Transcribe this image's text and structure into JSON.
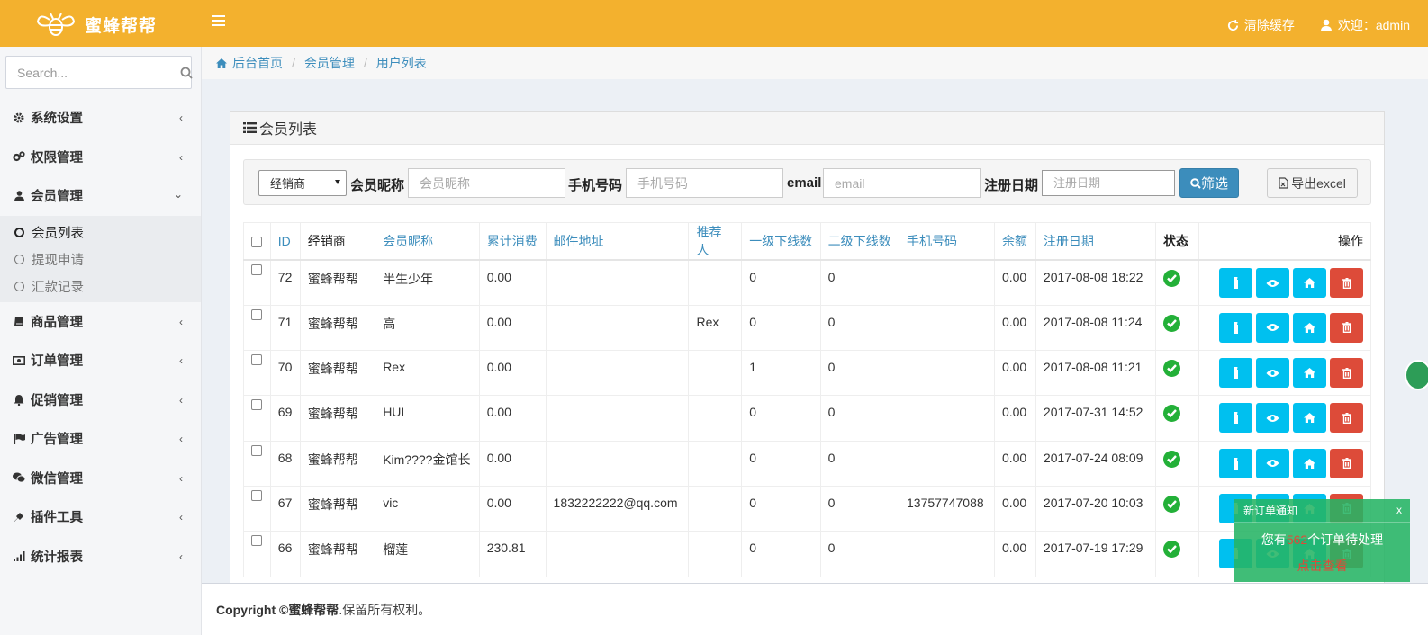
{
  "header": {
    "brand": "蜜蜂帮帮",
    "clear_cache": "清除缓存",
    "welcome": "欢迎：admin"
  },
  "sidebar": {
    "search_placeholder": "Search...",
    "items": [
      {
        "label": "系统设置",
        "icon": "gear-icon"
      },
      {
        "label": "权限管理",
        "icon": "gears-icon"
      },
      {
        "label": "会员管理",
        "icon": "user-icon",
        "open": true,
        "children": [
          {
            "label": "会员列表",
            "active": true
          },
          {
            "label": "提现申请"
          },
          {
            "label": "汇款记录"
          }
        ]
      },
      {
        "label": "商品管理",
        "icon": "book-icon"
      },
      {
        "label": "订单管理",
        "icon": "money-icon"
      },
      {
        "label": "促销管理",
        "icon": "bell-icon"
      },
      {
        "label": "广告管理",
        "icon": "flag-icon"
      },
      {
        "label": "微信管理",
        "icon": "wechat-icon"
      },
      {
        "label": "插件工具",
        "icon": "plug-icon"
      },
      {
        "label": "统计报表",
        "icon": "signal-icon"
      }
    ]
  },
  "breadcrumb": [
    "后台首页",
    "会员管理",
    "用户列表"
  ],
  "panel": {
    "title": "会员列表",
    "filter": {
      "dealer_selected": "经销商",
      "nickname_label": "会员昵称",
      "nickname_placeholder": "会员昵称",
      "phone_label": "手机号码",
      "phone_placeholder": "手机号码",
      "email_label": "email",
      "email_placeholder": "email",
      "date_label": "注册日期",
      "date_placeholder": "注册日期",
      "filter_button": "筛选",
      "export_button": "导出excel"
    }
  },
  "table": {
    "columns": [
      "ID",
      "经销商",
      "会员昵称",
      "累计消费",
      "邮件地址",
      "推荐人",
      "一级下线数",
      "二级下线数",
      "手机号码",
      "余额",
      "注册日期",
      "状态",
      "操作"
    ],
    "rows": [
      {
        "id": "72",
        "dealer": "蜜蜂帮帮",
        "nickname": "半生少年",
        "spend": "0.00",
        "email": "",
        "referrer": "",
        "l1": "0",
        "l2": "0",
        "phone": "",
        "balance": "0.00",
        "date": "2017-08-08 18:22"
      },
      {
        "id": "71",
        "dealer": "蜜蜂帮帮",
        "nickname": "高",
        "spend": "0.00",
        "email": "",
        "referrer": "Rex",
        "l1": "0",
        "l2": "0",
        "phone": "",
        "balance": "0.00",
        "date": "2017-08-08 11:24"
      },
      {
        "id": "70",
        "dealer": "蜜蜂帮帮",
        "nickname": "Rex",
        "spend": "0.00",
        "email": "",
        "referrer": "",
        "l1": "1",
        "l2": "0",
        "phone": "",
        "balance": "0.00",
        "date": "2017-08-08 11:21"
      },
      {
        "id": "69",
        "dealer": "蜜蜂帮帮",
        "nickname": "HUI",
        "spend": "0.00",
        "email": "",
        "referrer": "",
        "l1": "0",
        "l2": "0",
        "phone": "",
        "balance": "0.00",
        "date": "2017-07-31 14:52"
      },
      {
        "id": "68",
        "dealer": "蜜蜂帮帮",
        "nickname": "Kim????金馆长",
        "spend": "0.00",
        "email": "",
        "referrer": "",
        "l1": "0",
        "l2": "0",
        "phone": "",
        "balance": "0.00",
        "date": "2017-07-24 08:09"
      },
      {
        "id": "67",
        "dealer": "蜜蜂帮帮",
        "nickname": "vic",
        "spend": "0.00",
        "email": "1832222222@qq.com",
        "referrer": "",
        "l1": "0",
        "l2": "0",
        "phone": "13757747088",
        "balance": "0.00",
        "date": "2017-07-20 10:03"
      },
      {
        "id": "66",
        "dealer": "蜜蜂帮帮",
        "nickname": "榴莲",
        "spend": "230.81",
        "email": "",
        "referrer": "",
        "l1": "0",
        "l2": "0",
        "phone": "",
        "balance": "0.00",
        "date": "2017-07-19 17:29"
      }
    ]
  },
  "footer": {
    "prefix": "Copyright © ",
    "brand": "蜜蜂帮帮",
    "suffix": ".保留所有权利。"
  },
  "notice": {
    "title": "新订单通知",
    "close": "x",
    "text_before": "您有",
    "count": "562",
    "text_after": "个订单待处理",
    "link": "点击查看"
  },
  "colors": {
    "header_bg": "#f3b12e",
    "link_blue": "#3c8dbc",
    "cyan_button": "#00c0ef",
    "red_button": "#dd4b39",
    "status_green": "#23b038"
  }
}
